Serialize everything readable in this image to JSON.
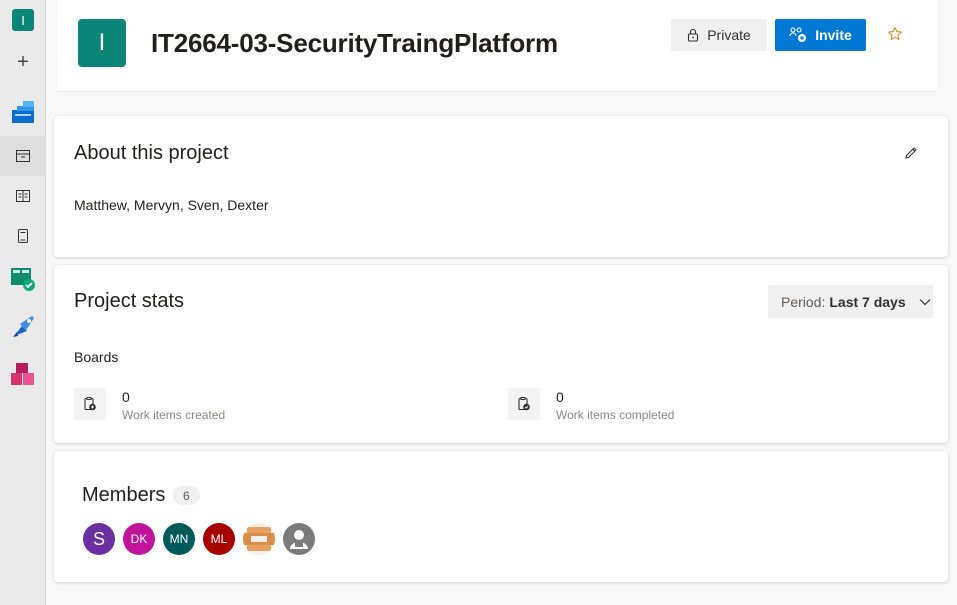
{
  "rail": {
    "org_initial": "I",
    "items": [
      {
        "name": "org-badge"
      },
      {
        "name": "new-project-button",
        "glyph": "+"
      },
      {
        "name": "boards-overview-icon"
      },
      {
        "name": "project-summary-icon"
      },
      {
        "name": "wiki-icon"
      },
      {
        "name": "dashboards-icon"
      },
      {
        "name": "boards-icon"
      },
      {
        "name": "pipelines-icon"
      },
      {
        "name": "artifacts-icon"
      }
    ]
  },
  "header": {
    "avatar_initial": "I",
    "project_title": "IT2664-03-SecurityTraingPlatform",
    "private_label": "Private",
    "invite_label": "Invite"
  },
  "about": {
    "title": "About this project",
    "description": "Matthew, Mervyn, Sven, Dexter"
  },
  "stats": {
    "title": "Project stats",
    "period_label": "Period:",
    "period_value": "Last 7 days",
    "boards_label": "Boards",
    "items": [
      {
        "value": "0",
        "label": "Work items created"
      },
      {
        "value": "0",
        "label": "Work items completed"
      }
    ]
  },
  "members": {
    "title": "Members",
    "count": "6",
    "avatars": [
      {
        "initials": "S",
        "color": "#6b2fa0"
      },
      {
        "initials": "DK",
        "color": "#c2139c"
      },
      {
        "initials": "MN",
        "color": "#005a5a"
      },
      {
        "initials": "ML",
        "color": "#a80000"
      },
      {
        "initials": "",
        "color": "#f5f0e8"
      },
      {
        "initials": "",
        "color": "#7a7a7a"
      }
    ]
  },
  "colors": {
    "accent": "#0078d4",
    "project_teal": "#0b8577",
    "star": "#d38a2c"
  }
}
